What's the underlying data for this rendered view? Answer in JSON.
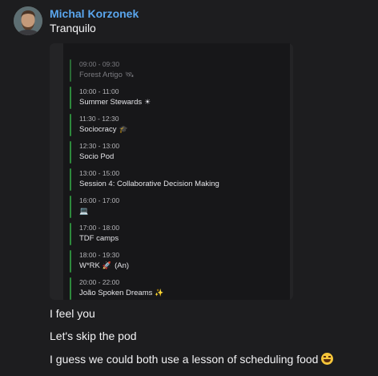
{
  "sender": {
    "name": "Michal Korzonek"
  },
  "messages": {
    "first": "Tranquilo",
    "feel": "I feel you",
    "skip": "Let's skip the pod",
    "guess": "I guess we could both use a lesson of scheduling food"
  },
  "icons": {
    "avatar": "profile-photo",
    "laugh": "tears-of-joy-emoji"
  },
  "colors": {
    "sender_name": "#5aa6ee",
    "event_bar": "#2e8a3c",
    "background": "#1d1d1f"
  },
  "events": [
    {
      "time": "09:00 - 09:30",
      "title": "Forest Artigo",
      "emoji": "🛰",
      "past": true
    },
    {
      "time": "10:00 - 11:00",
      "title": "Summer Stewards",
      "emoji": "☀",
      "past": false
    },
    {
      "time": "11:30 - 12:30",
      "title": "Sociocracy",
      "emoji": "🎓",
      "past": false
    },
    {
      "time": "12:30 - 13:00",
      "title": "Socio Pod",
      "emoji": "",
      "past": false
    },
    {
      "time": "13:00 - 15:00",
      "title": "Session 4: Collaborative Decision Making",
      "emoji": "",
      "past": false
    },
    {
      "time": "16:00 - 17:00",
      "title": "",
      "emoji": "💻",
      "past": false
    },
    {
      "time": "17:00 - 18:00",
      "title": "TDF camps",
      "emoji": "",
      "past": false
    },
    {
      "time": "18:00 - 19:30",
      "title": "W*RK",
      "emoji": "🚀",
      "suffix": "(An)",
      "past": false
    },
    {
      "time": "20:00 - 22:00",
      "title": "João Spoken Dreams",
      "emoji": "✨",
      "past": false
    }
  ]
}
